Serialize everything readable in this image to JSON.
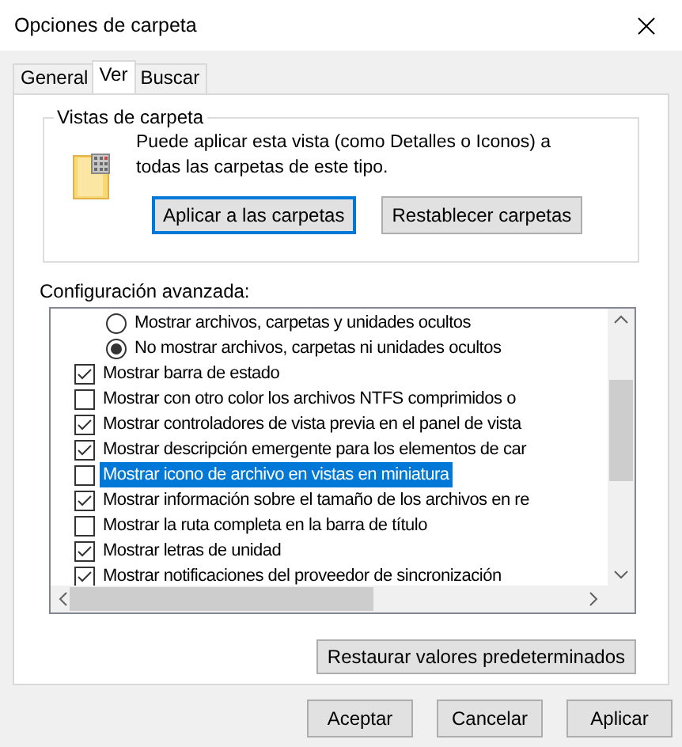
{
  "window": {
    "title": "Opciones de carpeta"
  },
  "tabs": [
    {
      "label": "General",
      "selected": false
    },
    {
      "label": "Ver",
      "selected": true
    },
    {
      "label": "Buscar",
      "selected": false
    }
  ],
  "folder_views": {
    "title": "Vistas de carpeta",
    "description": "Puede aplicar esta vista (como Detalles o Iconos) a todas las carpetas de este tipo.",
    "buttons": [
      {
        "label": "Aplicar a las carpetas",
        "focused": true
      },
      {
        "label": "Restablecer carpetas",
        "focused": false
      }
    ]
  },
  "advanced": {
    "label": "Configuración avanzada:",
    "items": [
      {
        "kind": "radio",
        "label": "Mostrar archivos, carpetas y unidades ocultos",
        "checked": false,
        "selected": false
      },
      {
        "kind": "radio",
        "label": "No mostrar archivos, carpetas ni unidades ocultos",
        "checked": true,
        "selected": false
      },
      {
        "kind": "checkbox",
        "label": "Mostrar barra de estado",
        "checked": true,
        "selected": false
      },
      {
        "kind": "checkbox",
        "label": "Mostrar con otro color los archivos NTFS comprimidos o",
        "checked": false,
        "selected": false
      },
      {
        "kind": "checkbox",
        "label": "Mostrar controladores de vista previa en el panel de vista",
        "checked": true,
        "selected": false
      },
      {
        "kind": "checkbox",
        "label": "Mostrar descripción emergente para los elementos de car",
        "checked": true,
        "selected": false
      },
      {
        "kind": "checkbox",
        "label": "Mostrar icono de archivo en vistas en miniatura",
        "checked": false,
        "selected": true
      },
      {
        "kind": "checkbox",
        "label": "Mostrar información sobre el tamaño de los archivos en re",
        "checked": true,
        "selected": false
      },
      {
        "kind": "checkbox",
        "label": "Mostrar la ruta completa en la barra de título",
        "checked": false,
        "selected": false
      },
      {
        "kind": "checkbox",
        "label": "Mostrar letras de unidad",
        "checked": true,
        "selected": false
      },
      {
        "kind": "checkbox",
        "label": "Mostrar notificaciones del proveedor de sincronización",
        "checked": true,
        "selected": false
      }
    ],
    "restore_button": "Restaurar valores predeterminados"
  },
  "buttons": [
    {
      "label": "Aceptar"
    },
    {
      "label": "Cancelar"
    },
    {
      "label": "Aplicar"
    }
  ]
}
